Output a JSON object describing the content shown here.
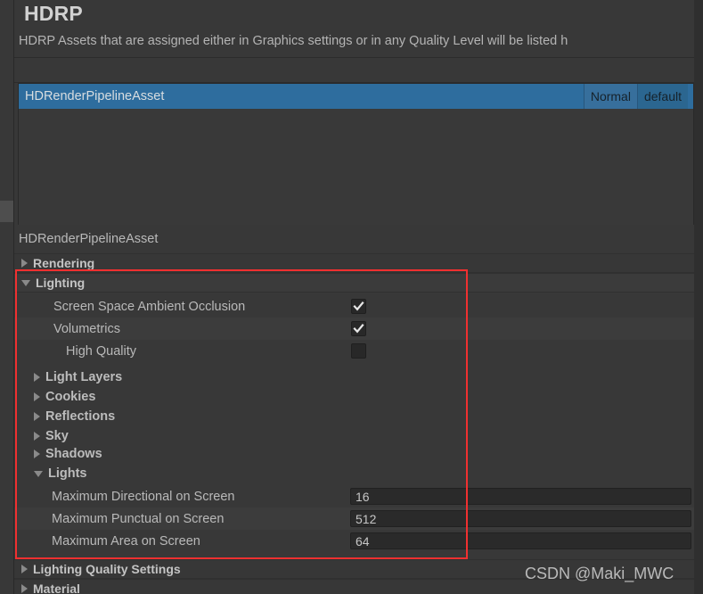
{
  "header": {
    "title": "HDRP",
    "description": "HDRP Assets that are assigned either in Graphics settings or in any Quality Level will be listed h"
  },
  "asset_list": {
    "selected_row": {
      "name": "HDRenderPipelineAsset",
      "badge_quality": "Normal",
      "badge_level": "default"
    }
  },
  "inspector": {
    "asset_name": "HDRenderPipelineAsset",
    "sections": [
      {
        "label": "Rendering",
        "expanded": false
      },
      {
        "label": "Lighting",
        "expanded": true
      },
      {
        "label": "Lighting Quality Settings",
        "expanded": false
      },
      {
        "label": "Material",
        "expanded": false
      }
    ],
    "lighting": {
      "toggles": [
        {
          "label": "Screen Space Ambient Occlusion",
          "checked": true
        },
        {
          "label": "Volumetrics",
          "checked": true
        },
        {
          "label": "High Quality",
          "checked": false
        }
      ],
      "subsections": [
        {
          "label": "Light Layers",
          "expanded": false
        },
        {
          "label": "Cookies",
          "expanded": false
        },
        {
          "label": "Reflections",
          "expanded": false
        },
        {
          "label": "Sky",
          "expanded": false
        },
        {
          "label": "Shadows",
          "expanded": false
        },
        {
          "label": "Lights",
          "expanded": true
        }
      ],
      "lights_fields": [
        {
          "label": "Maximum Directional on Screen",
          "value": "16"
        },
        {
          "label": "Maximum Punctual on Screen",
          "value": "512"
        },
        {
          "label": "Maximum Area on Screen",
          "value": "64"
        }
      ]
    }
  },
  "annotation": {
    "highlight_color": "#f03030"
  },
  "watermark": {
    "text": "CSDN @Maki_MWC"
  }
}
